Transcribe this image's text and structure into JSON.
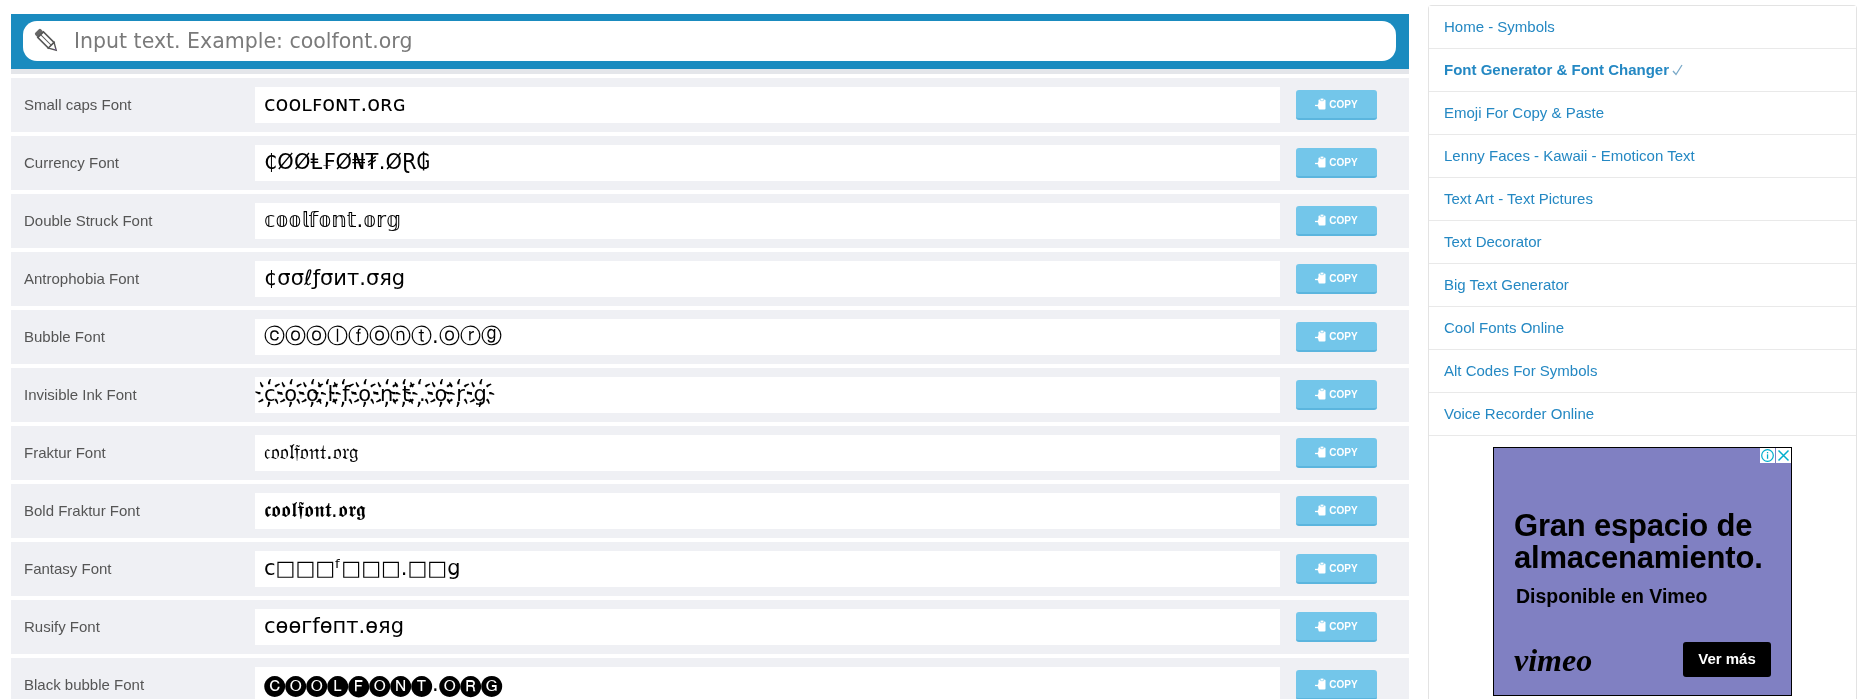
{
  "text_input": {
    "placeholder": "Input text. Example: coolfont.org"
  },
  "font_rows": [
    {
      "label": "Small caps Font",
      "output": "ᴄᴏᴏʟꜰᴏɴᴛ.ᴏʀɢ",
      "button": "COPY"
    },
    {
      "label": "Currency Font",
      "output": "₵ØØⱠ₣Ø₦₮.ØⱤ₲",
      "button": "COPY"
    },
    {
      "label": "Double Struck Font",
      "output": "𝕔𝕠𝕠𝕝𝕗𝕠𝕟𝕥.𝕠𝕣𝕘",
      "button": "COPY"
    },
    {
      "label": "Antrophobia Font",
      "output": "¢σσℓƒσит.σяg",
      "button": "COPY"
    },
    {
      "label": "Bubble Font",
      "output": "ⓒⓞⓞⓛⓕⓞⓝⓣ.ⓞⓡⓖ",
      "button": "COPY"
    },
    {
      "label": "Invisible Ink Font",
      "output": "c҉o҉o҉l҉f҉o҉n҉t҉.҉o҉r҉g҉",
      "button": "COPY"
    },
    {
      "label": "Fraktur Font",
      "output": "𝔠𝔬𝔬𝔩𝔣𝔬𝔫𝔱.𝔬𝔯𝔤",
      "button": "COPY"
    },
    {
      "label": "Bold Fraktur Font",
      "output": "𝖈𝖔𝖔𝖑𝖋𝖔𝖓𝖙.𝖔𝖗𝖌",
      "button": "COPY"
    },
    {
      "label": "Fantasy Font",
      "output": "c□□□ᶠ□□□.□□ց",
      "button": "COPY"
    },
    {
      "label": "Rusify Font",
      "output": "cөөгfөпт.өяg",
      "button": "COPY"
    },
    {
      "label": "Black bubble Font",
      "output": "🅒🅞🅞🅛🅕🅞🅝🅣.🅞🅡🅖",
      "button": "COPY"
    }
  ],
  "sidebar": {
    "items": [
      {
        "label": "Home - Symbols",
        "selected": false
      },
      {
        "label": "Font Generator & Font Changer",
        "selected": true
      },
      {
        "label": "Emoji For Copy & Paste",
        "selected": false
      },
      {
        "label": "Lenny Faces - Kawaii - Emoticon Text",
        "selected": false
      },
      {
        "label": "Text Art - Text Pictures",
        "selected": false
      },
      {
        "label": "Text Decorator",
        "selected": false
      },
      {
        "label": "Big Text Generator",
        "selected": false
      },
      {
        "label": "Cool Fonts Online",
        "selected": false
      },
      {
        "label": "Alt Codes For Symbols",
        "selected": false
      },
      {
        "label": "Voice Recorder Online",
        "selected": false
      }
    ]
  },
  "ad": {
    "headline": "Gran espacio de almacenamiento.",
    "subline": "Disponible en Vimeo",
    "logo": "vimeo",
    "button": "Ver más"
  }
}
